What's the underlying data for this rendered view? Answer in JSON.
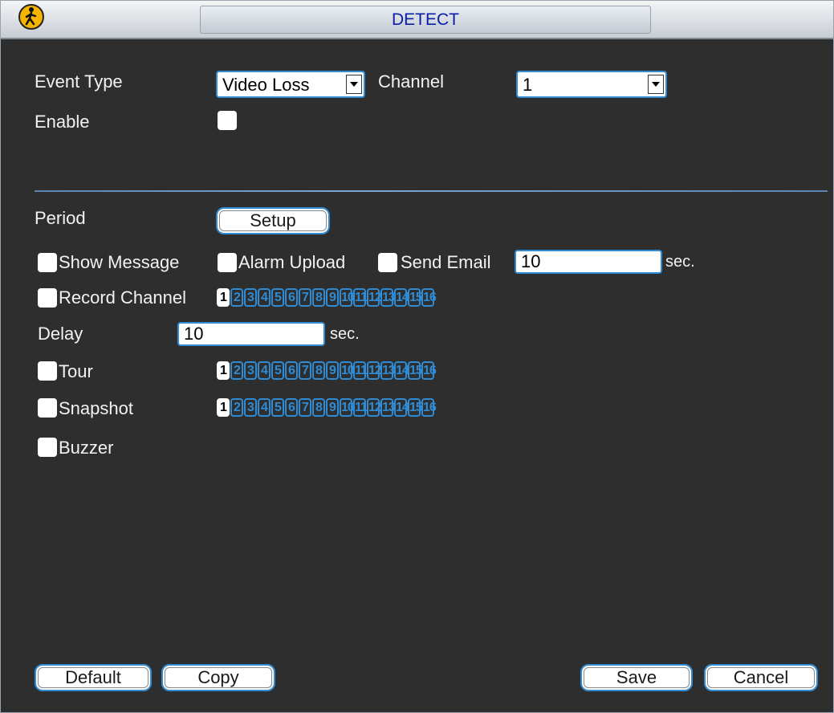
{
  "window": {
    "title": "DETECT",
    "logo_icon": "pedestrian-sign-icon"
  },
  "event": {
    "event_type_label": "Event Type",
    "event_type_value": "Video Loss",
    "channel_label": "Channel",
    "channel_value": "1",
    "enable_label": "Enable",
    "enable_checked": true
  },
  "period": {
    "label": "Period",
    "setup_button": "Setup"
  },
  "actions": {
    "show_message": "Show Message",
    "alarm_upload": "Alarm Upload",
    "send_email": "Send Email",
    "email_interval": "10",
    "email_unit": "sec.",
    "record_channel": "Record Channel",
    "delay_label": "Delay",
    "delay_value": "10",
    "delay_unit": "sec.",
    "tour": "Tour",
    "snapshot": "Snapshot",
    "buzzer": "Buzzer"
  },
  "channels": [
    "1",
    "2",
    "3",
    "4",
    "5",
    "6",
    "7",
    "8",
    "9",
    "10",
    "11",
    "12",
    "13",
    "14",
    "15",
    "16"
  ],
  "selected_channel": "1",
  "footer": {
    "default": "Default",
    "copy": "Copy",
    "save": "Save",
    "cancel": "Cancel"
  },
  "colors": {
    "accent": "#2f8bd3",
    "background": "#2e2e2e",
    "title_text": "#0a1ea8"
  }
}
